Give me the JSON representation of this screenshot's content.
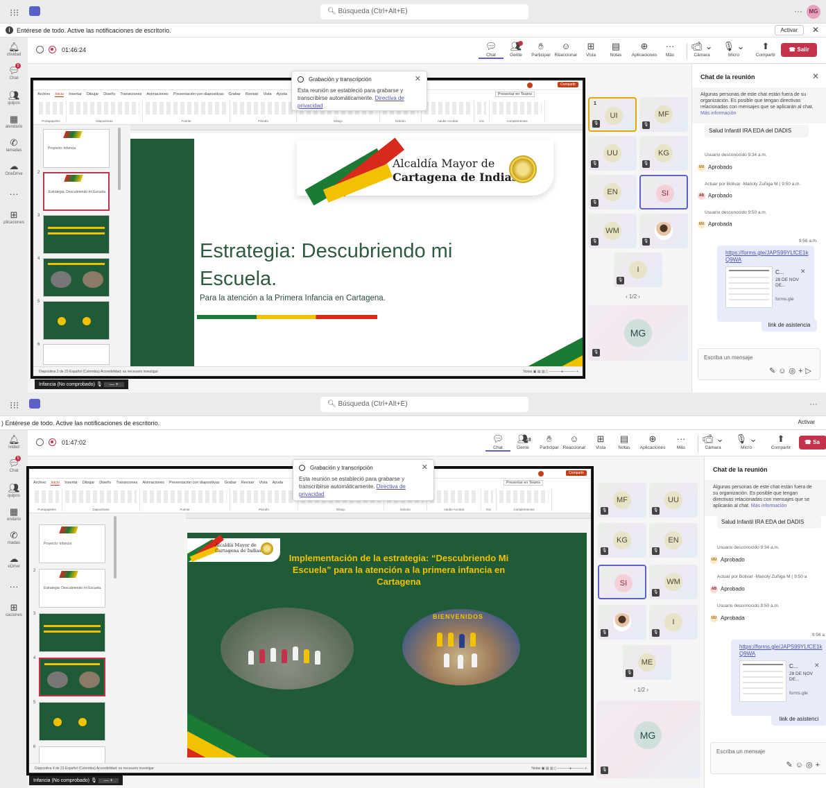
{
  "search_placeholder": "Búsqueda (Ctrl+Alt+E)",
  "avatar_initials": "MG",
  "notification": {
    "text_full": "Entérese de todo. Active las notificaciones de escritorio.",
    "text_crop": ") Entérese de todo. Active las notificaciones de escritorio.",
    "button": "Activar"
  },
  "rail_full": [
    "Actividad",
    "Chat",
    "Equipos",
    "Calendario",
    "Llamadas",
    "OneDrive",
    "Aplicaciones"
  ],
  "rail_crop": [
    "ividad",
    "Chat",
    "quipos",
    "endario",
    "madas",
    "eDrive",
    "caciones"
  ],
  "rail_crop_first": [
    "ctividad",
    "Chat",
    "quipos",
    "alendario",
    "lamadas",
    "OneDrive",
    "plicaciones"
  ],
  "rail_badge": "5",
  "meeting": {
    "timer1": "01:46:24",
    "timer2": "01:47:02",
    "controls": [
      "Chat",
      "Gente",
      "Participar",
      "Reaccionar",
      "Vista",
      "Notas",
      "Aplicaciones",
      "Más"
    ],
    "devices": [
      "Cámara",
      "Micro",
      "Compartir"
    ],
    "leave": "Salir",
    "leave_crop": "Sa",
    "people_count": "18"
  },
  "popup": {
    "title": "Grabación y transcripción",
    "body": "Esta reunión se estableció para grabarse y transcribirse automáticamente.",
    "link": "Directiva de privacidad"
  },
  "ppt": {
    "menu": [
      "Archivo",
      "Inicio",
      "Insertar",
      "Dibujar",
      "Diseño",
      "Transiciones",
      "Animaciones",
      "Presentación con diapositivas",
      "Grabar",
      "Revisar",
      "Vista",
      "Ayuda"
    ],
    "groups": [
      "Portapapeles",
      "Diapositivas",
      "Fuente",
      "Párrafo",
      "Dibujo",
      "Edición",
      "Adobe Acrobat",
      "Voz",
      "Complementos"
    ],
    "present_btn": "Presentar en Teams",
    "share_btn": "Compartir",
    "status1": "Diapositiva 2 de 23    Español (Colombia)    Accesibilidad: es necesario investigar",
    "status2": "Diapositiva 4 de 23    Español (Colombia)    Accesibilidad: es necesario investigar",
    "notes": "Notas",
    "thumb_texts": [
      "Proyecto: Infancia",
      "Estrategia: Descubriendo mi Escuela."
    ]
  },
  "slide1": {
    "logo_line1": "Alcaldía Mayor de",
    "logo_line2": "Cartagena de Indias",
    "title": "Estrategia: Descubriendo mi Escuela.",
    "subtitle": "Para la atención a la Primera Infancia en Cartagena."
  },
  "slide2": {
    "logo_line1": "Alcaldía Mayor de",
    "logo_line2": "Cartagena de Indias",
    "title": "Implementación de la estrategia: “Descubriendo Mi Escuela” para la atención a la primera infancia en Cartagena",
    "photo_text": "BIENVENIDOS"
  },
  "caption": "Infancia (No comprobado)",
  "gallery1": [
    "UI",
    "MF",
    "UU",
    "KG",
    "EN",
    "SI",
    "WM",
    "",
    "I"
  ],
  "gallery2": [
    "MF",
    "UU",
    "KG",
    "EN",
    "SI",
    "WM",
    "",
    "I",
    "ME"
  ],
  "hand_count": "1",
  "pager": "1/2",
  "big_tile": "MG",
  "chat": {
    "title": "Chat de la reunión",
    "note": "Algunas personas de este chat están fuera de su organización. Es posible que tengan directivas relacionadas con mensajes que se aplicarán al chat.",
    "note_link": "Más información",
    "msg1": "Salud Infantil IRA EDA del DADIS",
    "s1": "Usuario desconocido  9:34 a.m.",
    "r1": "Aprobado",
    "s2": "Actuar por Bolivar -Marioly Zuñiga M (  9:50 a.m.",
    "s2b": "Actuar por Bolivar -Marioly Zuñiga M (  9:50 a",
    "r2": "Aprobado",
    "s3": "Usuario desconocido  9:50 a.m.",
    "r3": "Aprobada",
    "time": "9:56 a.m.",
    "time_crop": "9:56 a",
    "url": "https://forms.gle/JAPS99YLfCE1kQ9WA",
    "card_title": "C...",
    "card_desc": "28 DE NOV DE...",
    "card_domain": "forms.gle",
    "bubble": "link de asistencia",
    "bubble_crop": "link de asistenci",
    "compose": "Escriba un mensaje",
    "uu": "UU",
    "ab": "AB"
  }
}
